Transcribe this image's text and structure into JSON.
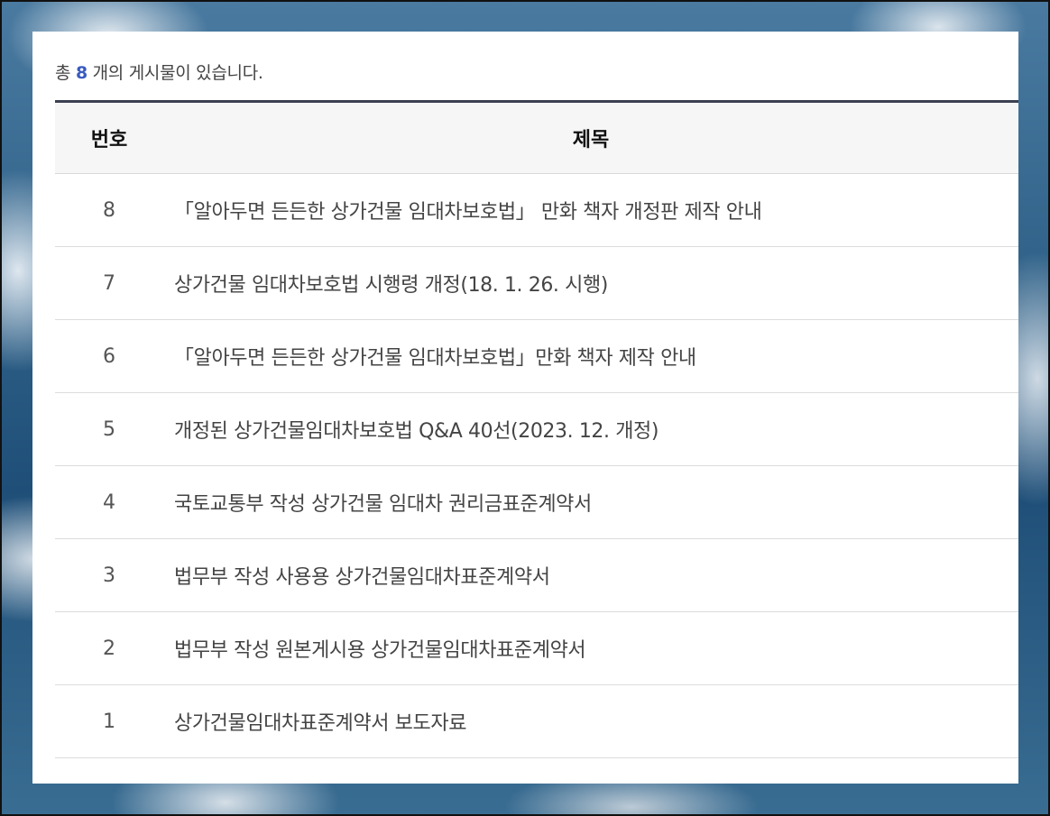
{
  "summary": {
    "prefix": "총",
    "count": "8",
    "suffix": "개의 게시물이 있습니다."
  },
  "table": {
    "headers": {
      "no": "번호",
      "title": "제목"
    },
    "rows": [
      {
        "no": "8",
        "title": "「알아두면 든든한 상가건물 임대차보호법」 만화 책자 개정판 제작 안내"
      },
      {
        "no": "7",
        "title": "상가건물 임대차보호법 시행령 개정(18. 1. 26. 시행)"
      },
      {
        "no": "6",
        "title": "「알아두면 든든한 상가건물 임대차보호법」만화 책자 제작 안내"
      },
      {
        "no": "5",
        "title": "개정된 상가건물임대차보호법 Q&A 40선(2023. 12. 개정)"
      },
      {
        "no": "4",
        "title": "국토교통부 작성 상가건물 임대차 권리금표준계약서"
      },
      {
        "no": "3",
        "title": "법무부 작성 사용용 상가건물임대차표준계약서"
      },
      {
        "no": "2",
        "title": "법무부 작성 원본게시용 상가건물임대차표준계약서"
      },
      {
        "no": "1",
        "title": "상가건물임대차표준계약서 보도자료"
      }
    ]
  },
  "colors": {
    "accent": "#3a5bbf",
    "header_rule": "#3b3f52"
  }
}
